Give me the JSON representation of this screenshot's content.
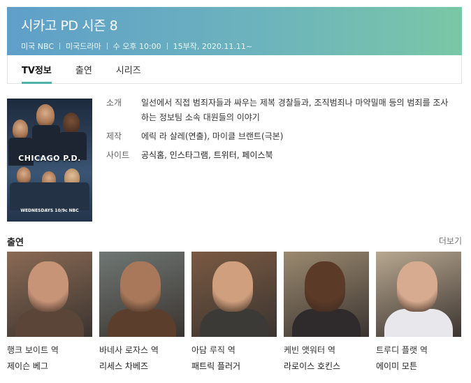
{
  "header": {
    "title": "시카고 PD 시즌 8",
    "country": "미국 NBC",
    "genre": "미국드라마",
    "schedule": "수 오후 10:00",
    "episodes": "15부작, 2020.11.11~"
  },
  "tabs": [
    {
      "label": "TV정보",
      "active": true
    },
    {
      "label": "출연",
      "active": false
    },
    {
      "label": "시리즈",
      "active": false
    }
  ],
  "poster": {
    "title": "CHICAGO P.D.",
    "footer": "WEDNESDAYS 10/9c NBC"
  },
  "info": {
    "intro_label": "소개",
    "intro_text": "일선에서 직접 범죄자들과 싸우는 제복 경찰들과, 조직범죄나 마약밀매 등의 범죄를 조사하는 정보팀 소속 대원들의 이야기",
    "production_label": "제작",
    "production_text": "에릭 라 살레(연출), 마이클 브랜트(극본)",
    "site_label": "사이트",
    "site_links": [
      "공식홈",
      "인스타그램",
      "트위터",
      "페이스북"
    ]
  },
  "cast_section": {
    "title": "출연",
    "more": "더보기",
    "members": [
      {
        "actor": "행크 보이트 역",
        "role": "제이슨 베그",
        "bg": "#8a6a54",
        "skin": "#c89478",
        "shirt": "#5a4538"
      },
      {
        "actor": "바네사 로자스 역",
        "role": "리세스 차베즈",
        "bg": "#6f7774",
        "skin": "#a9785a",
        "shirt": "#5b3f2c"
      },
      {
        "actor": "아담 루직 역",
        "role": "패트릭 플러거",
        "bg": "#7a5a42",
        "skin": "#d0a07e",
        "shirt": "#3c3a36"
      },
      {
        "actor": "케빈 앳워터 역",
        "role": "라로이스 호킨스",
        "bg": "#9b8a70",
        "skin": "#5b3a28",
        "shirt": "#2f2a2c"
      },
      {
        "actor": "트루디 플랫 역",
        "role": "에이미 모튼",
        "bg": "#b8a890",
        "skin": "#d7ab90",
        "shirt": "#e8e8ec"
      }
    ]
  }
}
